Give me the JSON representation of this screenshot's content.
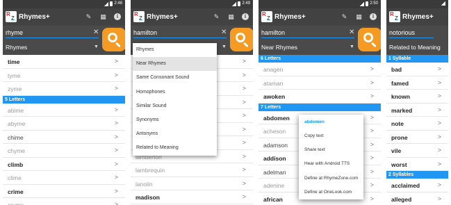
{
  "app": {
    "title": "Rhymes+"
  },
  "colors": {
    "accent": "#2196f3",
    "fab": "#f59a22",
    "appbar": "#424242",
    "statusbar": "#3a3a3a"
  },
  "icons": {
    "dictionary": "feather-pen-icon",
    "scanner": "qr-code-icon",
    "info": "info-icon",
    "search": "magnifier-icon",
    "clear": "close-icon",
    "caret": "dropdown-caret-icon",
    "chevron": "chevron-right-icon"
  },
  "screens": [
    {
      "time": "2:48",
      "query": "rhyme",
      "mode": "Rhymes",
      "rows": [
        {
          "type": "item",
          "text": "time",
          "style": "bold"
        },
        {
          "type": "item",
          "text": "tyme",
          "style": "light"
        },
        {
          "type": "item",
          "text": "zyme",
          "style": "light"
        },
        {
          "type": "section",
          "text": "5 Letters"
        },
        {
          "type": "item",
          "text": "abime",
          "style": "light"
        },
        {
          "type": "item",
          "text": "abyme",
          "style": "light"
        },
        {
          "type": "item",
          "text": "chime",
          "style": "med"
        },
        {
          "type": "item",
          "text": "chyme",
          "style": "light"
        },
        {
          "type": "item",
          "text": "climb",
          "style": "bold"
        },
        {
          "type": "item",
          "text": "clime",
          "style": "light"
        },
        {
          "type": "item",
          "text": "crime",
          "style": "bold"
        },
        {
          "type": "item",
          "text": "cryme",
          "style": "light"
        }
      ]
    },
    {
      "time": "2:49",
      "query": "hamilton",
      "mode": "",
      "dropdown": [
        "Rhymes",
        "Near Rhymes",
        "Same Consonant Sound",
        "Homophones",
        "Similar Sound",
        "Synonyms",
        "Antonyms",
        "Related to Meaning"
      ],
      "dropdown_selected": "Near Rhymes",
      "rows": [
        {
          "type": "item",
          "text": "",
          "style": "light"
        },
        {
          "type": "item",
          "text": "",
          "style": "light"
        },
        {
          "type": "item",
          "text": "",
          "style": "light"
        },
        {
          "type": "item",
          "text": "",
          "style": "light"
        },
        {
          "type": "item",
          "text": "",
          "style": "light"
        },
        {
          "type": "item",
          "text": "",
          "style": "light"
        },
        {
          "type": "item",
          "text": "",
          "style": "light"
        },
        {
          "type": "item",
          "text": "lamberton",
          "style": "light"
        },
        {
          "type": "item",
          "text": "lambrequin",
          "style": "light"
        },
        {
          "type": "item",
          "text": "lanolin",
          "style": "light"
        },
        {
          "type": "item",
          "text": "madison",
          "style": "bold"
        }
      ]
    },
    {
      "time": "2:50",
      "query": "hamilton",
      "mode": "Near Rhymes",
      "rows": [
        {
          "type": "section",
          "text": "6 Letters"
        },
        {
          "type": "item",
          "text": "anagen",
          "style": "light"
        },
        {
          "type": "item",
          "text": "ataman",
          "style": "light"
        },
        {
          "type": "item",
          "text": "awoken",
          "style": "bold"
        },
        {
          "type": "section",
          "text": "7 Letters"
        },
        {
          "type": "item",
          "text": "abdomen",
          "style": "bold"
        },
        {
          "type": "item",
          "text": "acheson",
          "style": "light"
        },
        {
          "type": "item",
          "text": "adamson",
          "style": "med"
        },
        {
          "type": "item",
          "text": "addison",
          "style": "bold"
        },
        {
          "type": "item",
          "text": "adelman",
          "style": "med"
        },
        {
          "type": "item",
          "text": "adenine",
          "style": "light"
        },
        {
          "type": "item",
          "text": "african",
          "style": "bold"
        }
      ],
      "context_menu": {
        "title": "abdomen",
        "items": [
          "Copy text",
          "Share text",
          "Hear with Android TTS",
          "Define at RhymeZone.com",
          "Define at OneLook.com"
        ]
      }
    },
    {
      "time": "",
      "query": "notorious",
      "mode": "Related to Meaning",
      "rows": [
        {
          "type": "section",
          "text": "1 Syllable"
        },
        {
          "type": "item",
          "text": "bad",
          "style": "bold"
        },
        {
          "type": "item",
          "text": "famed",
          "style": "bold"
        },
        {
          "type": "item",
          "text": "known",
          "style": "bold"
        },
        {
          "type": "item",
          "text": "marked",
          "style": "bold"
        },
        {
          "type": "item",
          "text": "note",
          "style": "bold"
        },
        {
          "type": "item",
          "text": "prone",
          "style": "bold"
        },
        {
          "type": "item",
          "text": "vile",
          "style": "bold"
        },
        {
          "type": "item",
          "text": "worst",
          "style": "bold"
        },
        {
          "type": "section",
          "text": "2 Syllables"
        },
        {
          "type": "item",
          "text": "acclaimed",
          "style": "bold"
        },
        {
          "type": "item",
          "text": "alleged",
          "style": "bold"
        }
      ]
    }
  ]
}
